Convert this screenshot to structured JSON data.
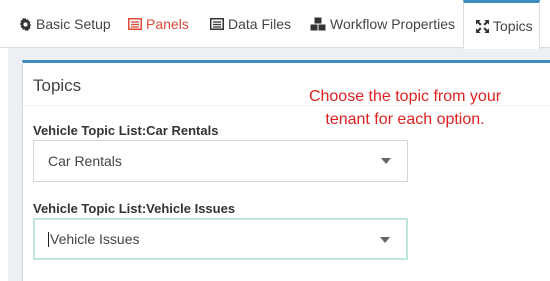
{
  "tabs": [
    {
      "label": "Basic Setup",
      "icon": "gear-icon"
    },
    {
      "label": "Panels",
      "icon": "panels-icon"
    },
    {
      "label": "Data Files",
      "icon": "list-icon"
    },
    {
      "label": "Workflow Properties",
      "icon": "cubes-icon"
    },
    {
      "label": "Topics",
      "icon": "expand-arrows-icon"
    }
  ],
  "active_tab": "Topics",
  "panel": {
    "title": "Topics",
    "hint": "Choose the topic from your tenant for each option."
  },
  "fields": [
    {
      "label": "Vehicle Topic List:Car Rentals",
      "value": "Car Rentals"
    },
    {
      "label": "Vehicle Topic List:Vehicle Issues",
      "value": "Vehicle Issues"
    }
  ],
  "colors": {
    "accent": "#3c8dbc",
    "hint": "#dd2222",
    "panels_tab": "#dd4b39"
  }
}
